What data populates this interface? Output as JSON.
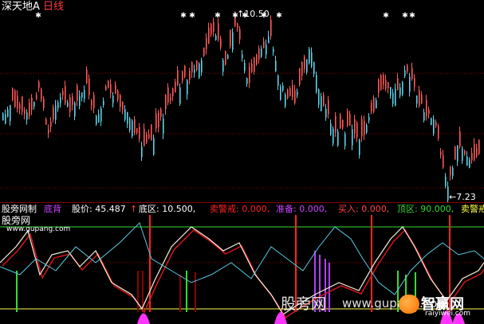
{
  "colors": {
    "background": "#000000",
    "up": "#ff5a5a",
    "down": "#5fd3e8",
    "white": "#ffffff",
    "green": "#33dd33",
    "magenta": "#ff33ff",
    "red": "#ff2222",
    "purple": "#b040ff",
    "yellow": "#ffff40",
    "wave_white": "#ffeedd",
    "wave_cyan": "#55cce0",
    "wave_red": "#d01818",
    "grid": "#8b0000"
  },
  "title_bar": {
    "stock_name": "深天地A",
    "period": "日线"
  },
  "top_chart": {
    "peak_label": "10.50",
    "low_label": "7.23",
    "star_glyph": "✱"
  },
  "indicator_bar": {
    "name": "股旁网制",
    "sub": "底背",
    "price_label": "股价: 45.487",
    "bottom_label": "底区: 10.500,",
    "sell_warn_label": "卖警戒: 0.000,",
    "prepare_label": "准备: 0.000,",
    "buy_label": "买入: 0.000,",
    "top_label": "顶区: 90.000,",
    "sell_warn2_label": "卖警戒"
  },
  "indicator_panel": {
    "brand": "股旁网",
    "url": "www.gupang.com"
  },
  "watermark": {
    "text1": "股旁网",
    "text2": "www.gupang.com",
    "logo_cn": "智赢网",
    "logo_en": "raiyiwei.com"
  },
  "chart_data": {
    "type": "candlestick",
    "title": "深天地A 日线",
    "y_max_label": "10.50",
    "y_min_label": "7.23"
  }
}
